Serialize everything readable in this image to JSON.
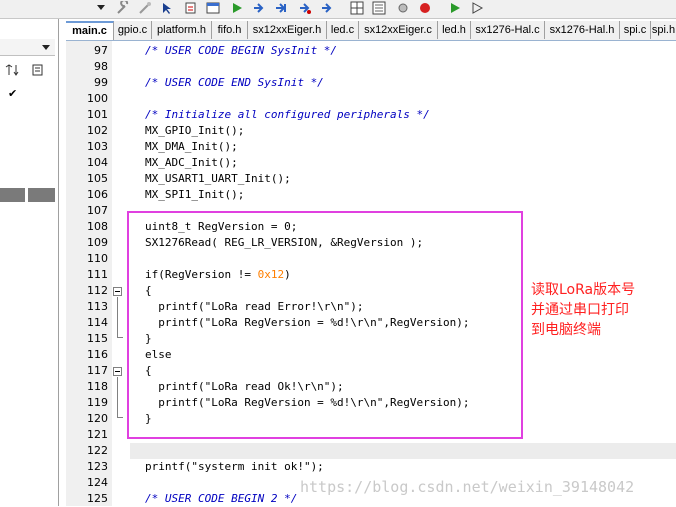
{
  "toolbar": {
    "icons": [
      "dropdown-arrow",
      "wrench-icon",
      "magic-wand-icon",
      "pointer-icon",
      "debug-icon",
      "window-icon",
      "run-icon",
      "forward-icon",
      "step-icon",
      "watch-icon",
      "stop-icon",
      "build-icon",
      "rebuild-icon"
    ]
  },
  "left_panel": {
    "icons": [
      "sort-icon",
      "properties-icon",
      "checkmark-icon"
    ],
    "check": "✔"
  },
  "tabs": [
    {
      "label": "main.c",
      "active": true
    },
    {
      "label": "gpio.c"
    },
    {
      "label": "platform.h"
    },
    {
      "label": "fifo.h"
    },
    {
      "label": "sx12xxEiger.h"
    },
    {
      "label": "led.c"
    },
    {
      "label": "sx12xxEiger.c"
    },
    {
      "label": "led.h"
    },
    {
      "label": "sx1276-Hal.c"
    },
    {
      "label": "sx1276-Hal.h"
    },
    {
      "label": "spi.c"
    },
    {
      "label": "spi.h"
    }
  ],
  "code_lines": [
    {
      "num": "97",
      "text": "/* USER CODE BEGIN SysInit */"
    },
    {
      "num": "98",
      "text": ""
    },
    {
      "num": "99",
      "text": "/* USER CODE END SysInit */"
    },
    {
      "num": "100",
      "text": ""
    },
    {
      "num": "101",
      "text": "/* Initialize all configured peripherals */"
    },
    {
      "num": "102",
      "text": "MX_GPIO_Init();"
    },
    {
      "num": "103",
      "text": "MX_DMA_Init();"
    },
    {
      "num": "104",
      "text": "MX_ADC_Init();"
    },
    {
      "num": "105",
      "text": "MX_USART1_UART_Init();"
    },
    {
      "num": "106",
      "text": "MX_SPI1_Init();"
    },
    {
      "num": "107",
      "text": ""
    },
    {
      "num": "108",
      "text": "uint8_t RegVersion = 0;"
    },
    {
      "num": "109",
      "text": "SX1276Read( REG_LR_VERSION, &RegVersion );"
    },
    {
      "num": "110",
      "text": ""
    },
    {
      "num": "111",
      "text": "if(RegVersion != 0x12)"
    },
    {
      "num": "112",
      "text": "{"
    },
    {
      "num": "113",
      "text": "  printf(\"LoRa read Error!\\r\\n\");"
    },
    {
      "num": "114",
      "text": "  printf(\"LoRa RegVersion = %d!\\r\\n\",RegVersion);"
    },
    {
      "num": "115",
      "text": "}"
    },
    {
      "num": "116",
      "text": "else"
    },
    {
      "num": "117",
      "text": "{"
    },
    {
      "num": "118",
      "text": "  printf(\"LoRa read Ok!\\r\\n\");"
    },
    {
      "num": "119",
      "text": "  printf(\"LoRa RegVersion = %d!\\r\\n\",RegVersion);"
    },
    {
      "num": "120",
      "text": "}"
    },
    {
      "num": "121",
      "text": ""
    },
    {
      "num": "122",
      "text": ""
    },
    {
      "num": "123",
      "text": "printf(\"systerm init ok!\");"
    },
    {
      "num": "124",
      "text": ""
    },
    {
      "num": "125",
      "text": "/* USER CODE BEGIN 2 */"
    }
  ],
  "annotation": {
    "lines": [
      "读取LoRa版本号",
      "并通过串口打印",
      "到电脑终端"
    ],
    "color": "#ff2020"
  },
  "highlight_color": "#e040e0",
  "watermark": "https://blog.csdn.net/weixin_39148042"
}
